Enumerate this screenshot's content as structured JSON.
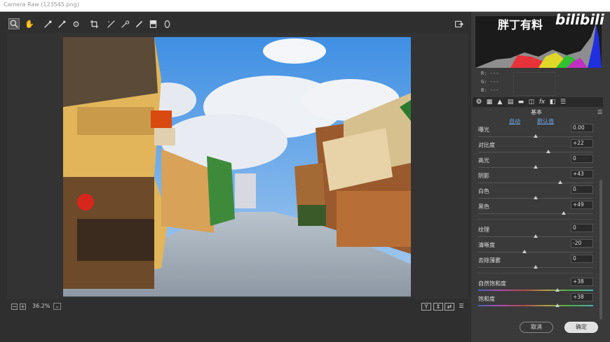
{
  "window": {
    "title": "Camera Raw (123545.png)"
  },
  "toolbar": {
    "tools": [
      "zoom-tool",
      "hand-tool",
      "white-balance-tool",
      "color-sampler-tool",
      "targeted-adjustment-tool",
      "crop-tool",
      "straighten-tool",
      "spot-removal-tool",
      "red-eye-tool",
      "adjustment-brush",
      "graduated-filter",
      "radial-filter"
    ],
    "open_preferences": "toggle-fullscreen"
  },
  "watermark": {
    "text_cn": "胖丁有料",
    "text_logo": "bilibili"
  },
  "info": {
    "r_label": "R:",
    "r_value": "---",
    "g_label": "G:",
    "g_value": "---",
    "b_label": "B:",
    "b_value": "---"
  },
  "panel": {
    "section_title": "基本",
    "auto_label": "自动",
    "default_label": "默认值",
    "sliders": [
      {
        "label": "曝光",
        "value": "0.00",
        "pos": 0.5
      },
      {
        "label": "对比度",
        "value": "+22",
        "pos": 0.61
      },
      {
        "label": "高光",
        "value": "0",
        "pos": 0.5
      },
      {
        "label": "阴影",
        "value": "+43",
        "pos": 0.715
      },
      {
        "label": "白色",
        "value": "0",
        "pos": 0.5
      },
      {
        "label": "黑色",
        "value": "+49",
        "pos": 0.745
      },
      {
        "label": "纹理",
        "value": "0",
        "pos": 0.5
      },
      {
        "label": "清晰度",
        "value": "-20",
        "pos": 0.4
      },
      {
        "label": "去除薄雾",
        "value": "0",
        "pos": 0.5
      },
      {
        "label": "自然饱和度",
        "value": "+38",
        "pos": 0.69
      },
      {
        "label": "饱和度",
        "value": "+38",
        "pos": 0.69
      }
    ]
  },
  "zoom": {
    "minus": "−",
    "plus": "+",
    "value": "36.2%",
    "dropdown": "⌄"
  },
  "view_buttons": {
    "y": "Y",
    "compare": "⇕",
    "swap": "⇄",
    "settings": "☰"
  },
  "buttons": {
    "cancel": "取消",
    "ok": "确定"
  }
}
